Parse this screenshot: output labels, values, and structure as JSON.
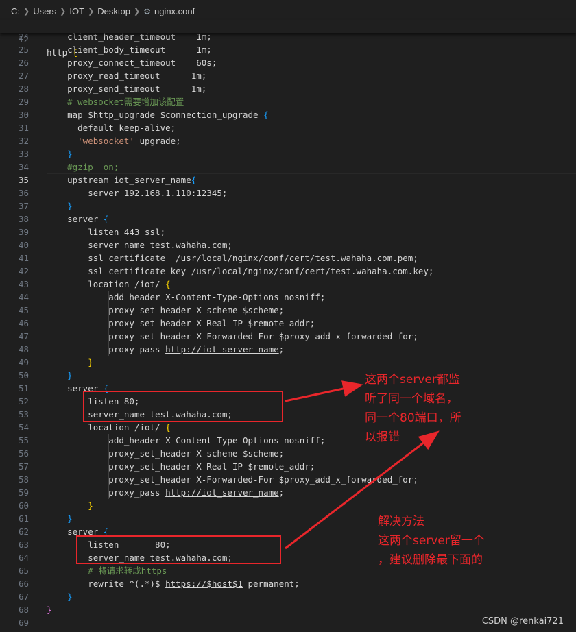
{
  "breadcrumb": {
    "parts": [
      "C:",
      "Users",
      "IOT",
      "Desktop",
      "nginx.conf"
    ]
  },
  "sticky_line": {
    "number": "12",
    "text": "http {"
  },
  "lines": [
    {
      "n": "24",
      "t": "    client_header_timeout    1m;"
    },
    {
      "n": "25",
      "t": "    client_body_timeout      1m;"
    },
    {
      "n": "26",
      "t": "    proxy_connect_timeout    60s;"
    },
    {
      "n": "27",
      "t": "    proxy_read_timeout      1m;"
    },
    {
      "n": "28",
      "t": "    proxy_send_timeout      1m;"
    },
    {
      "n": "29",
      "t": "    # websocket需要增加该配置"
    },
    {
      "n": "30",
      "t": "    map $http_upgrade $connection_upgrade {"
    },
    {
      "n": "31",
      "t": "      default keep-alive;"
    },
    {
      "n": "32",
      "t": "      'websocket' upgrade;"
    },
    {
      "n": "33",
      "t": "    }"
    },
    {
      "n": "34",
      "t": "    #gzip  on;"
    },
    {
      "n": "35",
      "t": "    upstream iot_server_name{"
    },
    {
      "n": "36",
      "t": "        server 192.168.1.110:12345;"
    },
    {
      "n": "37",
      "t": "    }"
    },
    {
      "n": "38",
      "t": "    server {"
    },
    {
      "n": "39",
      "t": "        listen 443 ssl;"
    },
    {
      "n": "40",
      "t": "        server_name test.wahaha.com;"
    },
    {
      "n": "41",
      "t": "        ssl_certificate  /usr/local/nginx/conf/cert/test.wahaha.com.pem;"
    },
    {
      "n": "42",
      "t": "        ssl_certificate_key /usr/local/nginx/conf/cert/test.wahaha.com.key;"
    },
    {
      "n": "43",
      "t": "        location /iot/ {"
    },
    {
      "n": "44",
      "t": "            add_header X-Content-Type-Options nosniff;"
    },
    {
      "n": "45",
      "t": "            proxy_set_header X-scheme $scheme;"
    },
    {
      "n": "46",
      "t": "            proxy_set_header X-Real-IP $remote_addr;"
    },
    {
      "n": "47",
      "t": "            proxy_set_header X-Forwarded-For $proxy_add_x_forwarded_for;"
    },
    {
      "n": "48",
      "t": "            proxy_pass http://iot_server_name;"
    },
    {
      "n": "49",
      "t": "        }"
    },
    {
      "n": "50",
      "t": "    }"
    },
    {
      "n": "51",
      "t": "    server {"
    },
    {
      "n": "52",
      "t": "        listen 80;"
    },
    {
      "n": "53",
      "t": "        server_name test.wahaha.com;"
    },
    {
      "n": "54",
      "t": "        location /iot/ {"
    },
    {
      "n": "55",
      "t": "            add_header X-Content-Type-Options nosniff;"
    },
    {
      "n": "56",
      "t": "            proxy_set_header X-scheme $scheme;"
    },
    {
      "n": "57",
      "t": "            proxy_set_header X-Real-IP $remote_addr;"
    },
    {
      "n": "58",
      "t": "            proxy_set_header X-Forwarded-For $proxy_add_x_forwarded_for;"
    },
    {
      "n": "59",
      "t": "            proxy_pass http://iot_server_name;"
    },
    {
      "n": "60",
      "t": "        }"
    },
    {
      "n": "61",
      "t": "    }"
    },
    {
      "n": "62",
      "t": "    server {"
    },
    {
      "n": "63",
      "t": "        listen       80;"
    },
    {
      "n": "64",
      "t": "        server_name test.wahaha.com;"
    },
    {
      "n": "65",
      "t": "        # 将请求转成https"
    },
    {
      "n": "66",
      "t": "        rewrite ^(.*)$ https://$host$1 permanent;"
    },
    {
      "n": "67",
      "t": "    }"
    },
    {
      "n": "68",
      "t": "}"
    },
    {
      "n": "69",
      "t": ""
    }
  ],
  "active_line": "35",
  "annotations": {
    "note1": [
      "这两个server都监",
      "听了同一个域名，",
      "同一个80端口，所",
      "以报错"
    ],
    "note2": [
      "解决方法",
      "这两个server留一个",
      "，建议删除最下面的"
    ]
  },
  "annotation_color": "#e8262b",
  "watermark": "CSDN @renkai721"
}
